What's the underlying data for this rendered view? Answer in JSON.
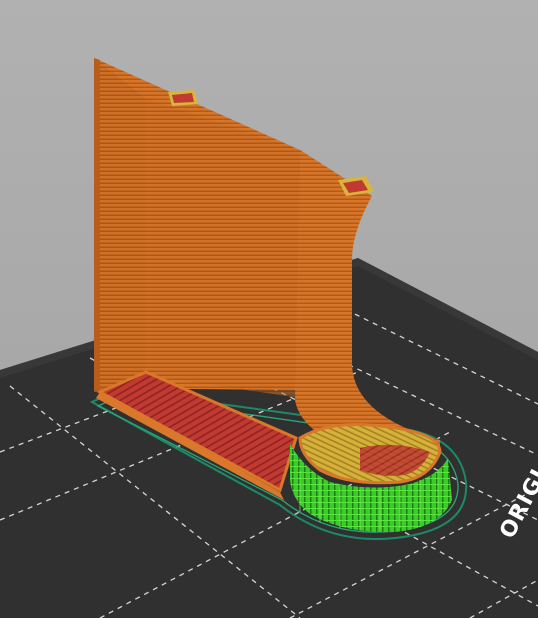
{
  "viewport": {
    "bed_label": "ORIGI",
    "colors": {
      "background": "#a9a9a9",
      "bed_surface": "#2f2f2f",
      "bed_grid": "#cfcfcf",
      "perimeter_orange": "#d9772a",
      "perimeter_dark": "#a14f14",
      "solid_infill_red": "#c23b33",
      "top_infill_yellow": "#d8b53c",
      "support_green": "#3fd42c",
      "skirt_teal": "#1f8a66"
    },
    "icons": [
      "print-bed",
      "sliced-model",
      "support-material",
      "skirt-outline"
    ]
  }
}
